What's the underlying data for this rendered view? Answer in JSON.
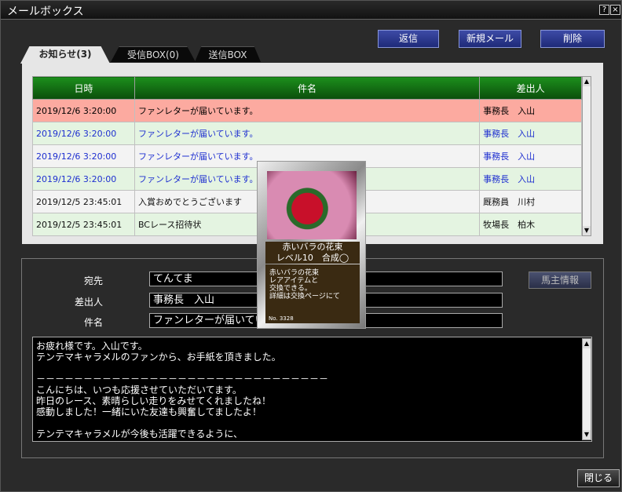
{
  "window": {
    "title": "メールボックス",
    "help_label": "?",
    "close_label": "×"
  },
  "toolbar": {
    "reply_label": "返信",
    "new_label": "新規メール",
    "delete_label": "削除"
  },
  "tabs": [
    {
      "label": "お知らせ(3)",
      "active": true
    },
    {
      "label": "受信BOX(0)",
      "active": false
    },
    {
      "label": "送信BOX",
      "active": false
    }
  ],
  "mail_table": {
    "headers": [
      "日時",
      "件名",
      "差出人"
    ],
    "rows": [
      {
        "date": "2019/12/6 3:20:00",
        "subject": "ファンレターが届いています。",
        "sender": "事務長　入山",
        "style": "pink"
      },
      {
        "date": "2019/12/6 3:20:00",
        "subject": "ファンレターが届いています。",
        "sender": "事務長　入山",
        "style": "green"
      },
      {
        "date": "2019/12/6 3:20:00",
        "subject": "ファンレターが届いています。",
        "sender": "事務長　入山",
        "style": "white"
      },
      {
        "date": "2019/12/6 3:20:00",
        "subject": "ファンレターが届いています。",
        "sender": "事務長　入山",
        "style": "green"
      },
      {
        "date": "2019/12/5 23:45:01",
        "subject": "入賞おめでとうございます",
        "sender": "厩務員　川村",
        "style": "white"
      },
      {
        "date": "2019/12/5 23:45:01",
        "subject": "BCレース招待状",
        "sender": "牧場長　柏木",
        "style": "green2"
      }
    ]
  },
  "detail": {
    "to_label": "宛先",
    "to_value": "てんてま",
    "from_label": "差出人",
    "from_value": "事務長　入山",
    "subject_label": "件名",
    "subject_value": "ファンレターが届いています。",
    "horse_info_label": "馬主情報",
    "body_lines": [
      "お疲れ様です。入山です。",
      "テンテマキャラメルのファンから、お手紙を頂きました。",
      "",
      "－－－－－－－－－－－－－－－－－－－－－－－－－－－－－－－",
      "こんにちは、いつも応援させていただいてます。",
      "昨日のレース、素晴らしい走りをみせてくれましたね！",
      "感動しました！一緒にいた友達も興奮してましたよ！",
      "",
      "テンテマキャラメルが今後も活躍できるように、"
    ]
  },
  "card": {
    "name": "赤いバラの花束",
    "level": "レベル10　合成◯",
    "desc_lines": [
      "赤いバラの花束",
      "レアアイテムと",
      "交換できる。",
      "詳細は交換ページにて"
    ],
    "number": "No. 3328"
  },
  "footer": {
    "close_label": "閉じる"
  }
}
